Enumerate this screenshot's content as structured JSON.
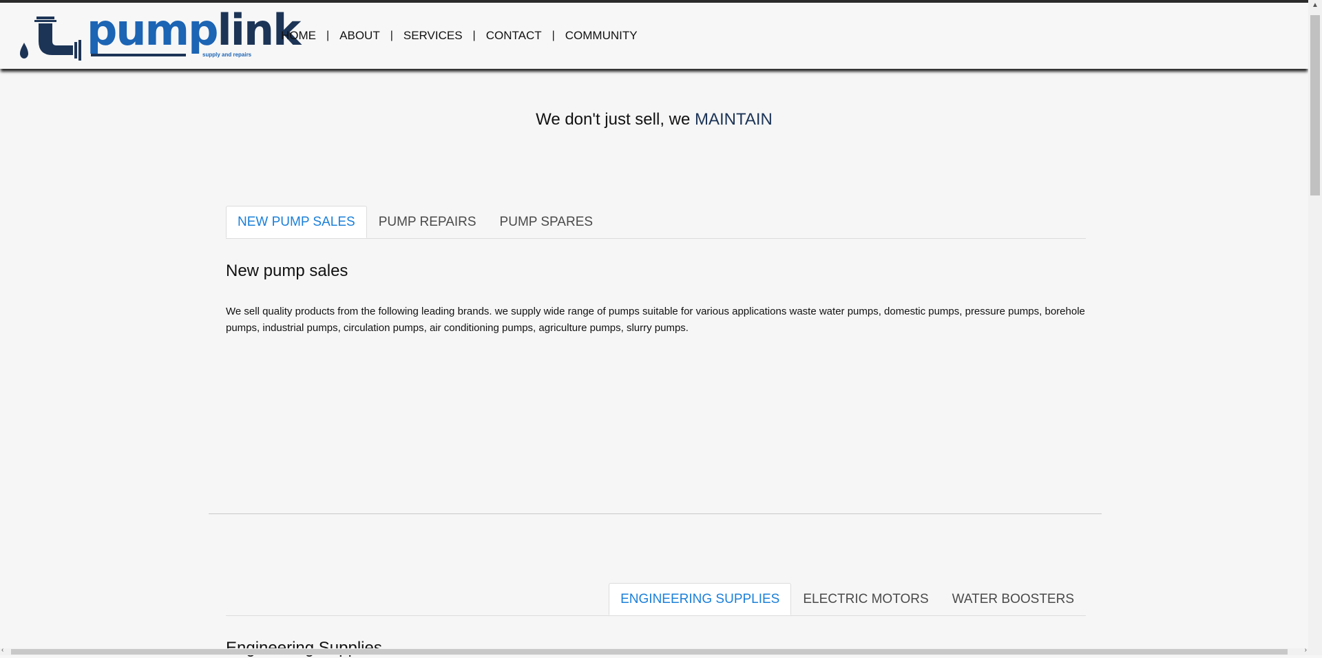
{
  "brand": {
    "name_part1": "pump",
    "name_part2": "link",
    "tagline": "supply and repairs",
    "colors": {
      "primary": "#1c64b4",
      "dark": "#1c3456"
    }
  },
  "nav": {
    "items": [
      {
        "label": "HOME"
      },
      {
        "label": "ABOUT"
      },
      {
        "label": "SERVICES"
      },
      {
        "label": "CONTACT"
      },
      {
        "label": "COMMUNITY"
      }
    ],
    "separator": "|"
  },
  "hero": {
    "text": "We don't just sell, we ",
    "accent": "MAINTAIN"
  },
  "section1": {
    "tabs": [
      {
        "label": "NEW PUMP SALES",
        "active": true
      },
      {
        "label": "PUMP REPAIRS",
        "active": false
      },
      {
        "label": "PUMP SPARES",
        "active": false
      }
    ],
    "title": "New pump sales",
    "body": "We sell quality products from the following leading brands. we supply wide range of pumps suitable for various applications waste water pumps, domestic pumps, pressure pumps, borehole pumps, industrial pumps, circulation pumps, air conditioning pumps, agriculture pumps, slurry pumps."
  },
  "section2": {
    "tabs": [
      {
        "label": "ENGINEERING SUPPLIES",
        "active": true
      },
      {
        "label": "ELECTRIC MOTORS",
        "active": false
      },
      {
        "label": "WATER BOOSTERS",
        "active": false
      }
    ],
    "title": "Engineering Supplies"
  },
  "icons": [
    "water-drop-icon",
    "pipe-elbow-icon",
    "scroll-up-arrow-icon",
    "scroll-left-arrow-icon",
    "scroll-right-arrow-icon"
  ]
}
